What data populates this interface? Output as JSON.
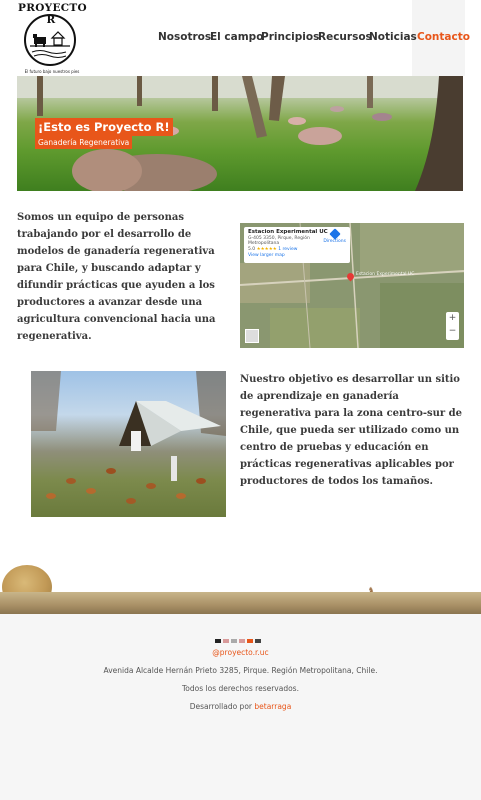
{
  "brand": {
    "name": "PROYECTO R",
    "tagline": "El futuro bajo nuestros pies"
  },
  "nav": {
    "items": [
      "Nosotros",
      "El campo",
      "Principios",
      "Recursos",
      "Noticias"
    ],
    "contact": "Contacto",
    "active_color": "#e8561a"
  },
  "hero": {
    "title": "¡Esto es Proyecto R!",
    "subtitle": "Ganadería Regenerativa"
  },
  "section1": {
    "text": "Somos un equipo de personas trabajando por el desarrollo de modelos de ganadería regenerativa para Chile, y buscando adaptar y difundir prácticas que ayuden a los productores a avanzar desde una agricultura convencional hacia una regenerativa."
  },
  "map": {
    "place": "Estacion Experimental UC",
    "address": "G-405 3350, Pirque, Región Metropolitana",
    "rating": "5.0",
    "stars": "★★★★★",
    "reviews": "1 review",
    "directions": "Directions",
    "larger": "View larger map",
    "pin_label": "Estacion Experimental UC",
    "zoom_in": "+",
    "zoom_out": "−"
  },
  "section2": {
    "text": "Nuestro objetivo es desarrollar un sitio de aprendizaje en ganadería regenerativa para la zona centro-sur de Chile, que pueda ser utilizado como un centro de pruebas y educación en prácticas regenerativas aplicables por productores de todos los tamaños."
  },
  "footer": {
    "instagram": "@proyecto.r.uc",
    "address": "Avenida Alcalde Hernán Prieto 3285, Pirque. Región Metropolitana, Chile.",
    "rights": "Todos los derechos reservados.",
    "dev_prefix": "Desarrollado por",
    "dev_link": "betarraga"
  }
}
